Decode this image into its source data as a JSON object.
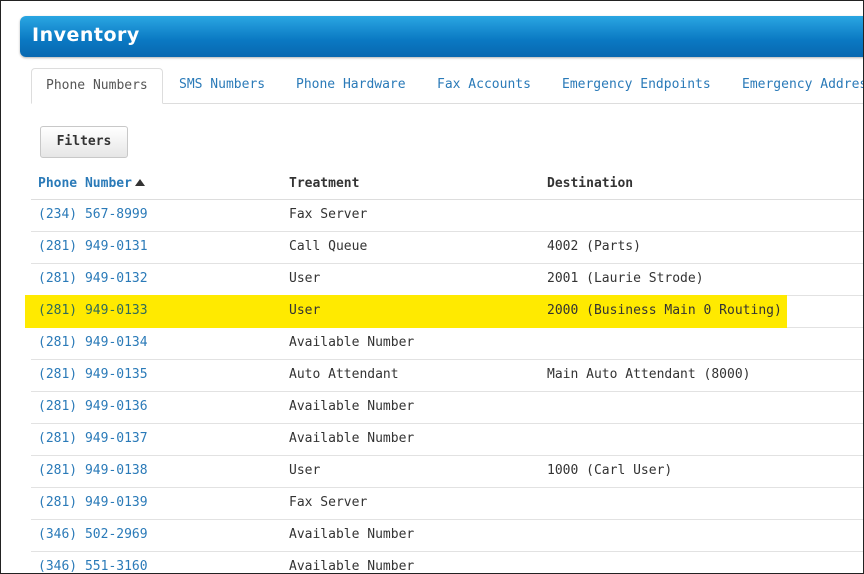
{
  "header": {
    "title": "Inventory"
  },
  "tabs": [
    {
      "label": "Phone Numbers",
      "active": true
    },
    {
      "label": "SMS Numbers",
      "active": false
    },
    {
      "label": "Phone Hardware",
      "active": false
    },
    {
      "label": "Fax Accounts",
      "active": false
    },
    {
      "label": "Emergency Endpoints",
      "active": false
    },
    {
      "label": "Emergency Addresses",
      "active": false
    }
  ],
  "toolbar": {
    "filters_label": "Filters"
  },
  "table": {
    "columns": [
      "Phone Number",
      "Treatment",
      "Destination"
    ],
    "sort": {
      "column": "Phone Number",
      "direction": "ascending"
    },
    "highlight_color": "#ffea00",
    "rows": [
      {
        "phone": "(234) 567-8999",
        "treatment": "Fax Server",
        "destination": "",
        "highlighted": false
      },
      {
        "phone": "(281) 949-0131",
        "treatment": "Call Queue",
        "destination": "4002 (Parts)",
        "highlighted": false
      },
      {
        "phone": "(281) 949-0132",
        "treatment": "User",
        "destination": "2001 (Laurie Strode)",
        "highlighted": false
      },
      {
        "phone": "(281) 949-0133",
        "treatment": "User",
        "destination": "2000 (Business Main 0 Routing)",
        "highlighted": true
      },
      {
        "phone": "(281) 949-0134",
        "treatment": "Available Number",
        "destination": "",
        "highlighted": false
      },
      {
        "phone": "(281) 949-0135",
        "treatment": "Auto Attendant",
        "destination": "Main Auto Attendant (8000)",
        "highlighted": false
      },
      {
        "phone": "(281) 949-0136",
        "treatment": "Available Number",
        "destination": "",
        "highlighted": false
      },
      {
        "phone": "(281) 949-0137",
        "treatment": "Available Number",
        "destination": "",
        "highlighted": false
      },
      {
        "phone": "(281) 949-0138",
        "treatment": "User",
        "destination": "1000 (Carl User)",
        "highlighted": false
      },
      {
        "phone": "(281) 949-0139",
        "treatment": "Fax Server",
        "destination": "",
        "highlighted": false
      },
      {
        "phone": "(346) 502-2969",
        "treatment": "Available Number",
        "destination": "",
        "highlighted": false
      },
      {
        "phone": "(346) 551-3160",
        "treatment": "Available Number",
        "destination": "",
        "highlighted": false
      }
    ]
  },
  "colors": {
    "header": "#0a78c2",
    "link": "#2a7ab8"
  }
}
